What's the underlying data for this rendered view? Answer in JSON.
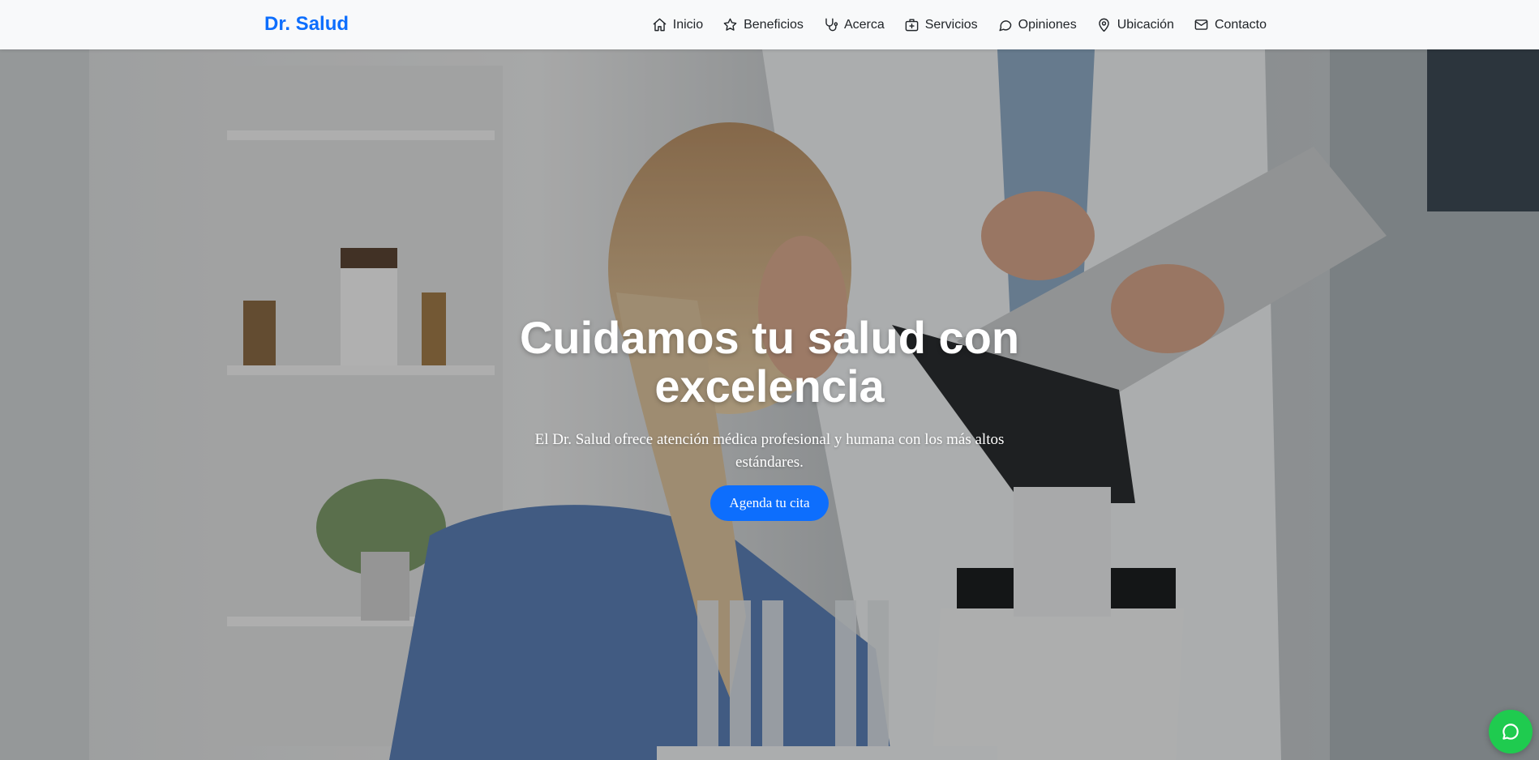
{
  "brand": {
    "name": "Dr. Salud",
    "color": "#0d6efd"
  },
  "nav": {
    "items": [
      {
        "label": "Inicio",
        "icon": "home-icon"
      },
      {
        "label": "Beneficios",
        "icon": "star-icon"
      },
      {
        "label": "Acerca",
        "icon": "stethoscope-icon"
      },
      {
        "label": "Servicios",
        "icon": "medical-kit-icon"
      },
      {
        "label": "Opiniones",
        "icon": "chat-bubble-icon"
      },
      {
        "label": "Ubicación",
        "icon": "map-pin-icon"
      },
      {
        "label": "Contacto",
        "icon": "envelope-icon"
      }
    ]
  },
  "hero": {
    "title": "Cuidamos tu salud con excelencia",
    "subtitle": "El Dr. Salud ofrece atención médica profesional y humana con los más altos estándares.",
    "cta_label": "Agenda tu cita",
    "background": "photo of a laboratory: a woman in blue scrubs looking into a microscope while a doctor in a white coat writes on a clipboard"
  },
  "floating": {
    "whatsapp_icon": "whatsapp-icon",
    "color": "#1fcb4f"
  },
  "colors": {
    "primary": "#0d6efd",
    "navbar_bg": "#f8f9fa",
    "text": "#212529"
  }
}
